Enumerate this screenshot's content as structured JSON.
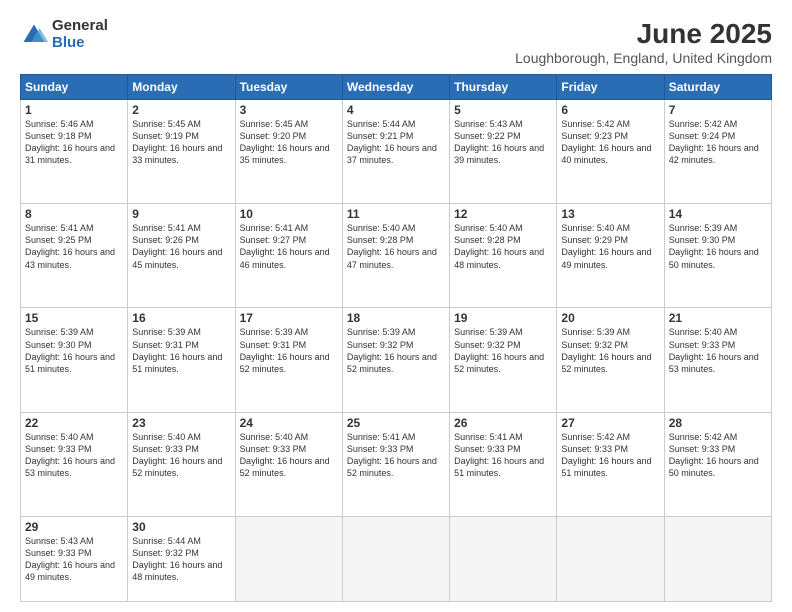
{
  "header": {
    "logo": {
      "general": "General",
      "blue": "Blue"
    },
    "title": "June 2025",
    "location": "Loughborough, England, United Kingdom"
  },
  "calendar": {
    "weekdays": [
      "Sunday",
      "Monday",
      "Tuesday",
      "Wednesday",
      "Thursday",
      "Friday",
      "Saturday"
    ],
    "weeks": [
      [
        null,
        {
          "day": "2",
          "sunrise": "5:45 AM",
          "sunset": "9:19 PM",
          "daylight": "16 hours and 33 minutes."
        },
        {
          "day": "3",
          "sunrise": "5:45 AM",
          "sunset": "9:20 PM",
          "daylight": "16 hours and 35 minutes."
        },
        {
          "day": "4",
          "sunrise": "5:44 AM",
          "sunset": "9:21 PM",
          "daylight": "16 hours and 37 minutes."
        },
        {
          "day": "5",
          "sunrise": "5:43 AM",
          "sunset": "9:22 PM",
          "daylight": "16 hours and 39 minutes."
        },
        {
          "day": "6",
          "sunrise": "5:42 AM",
          "sunset": "9:23 PM",
          "daylight": "16 hours and 40 minutes."
        },
        {
          "day": "7",
          "sunrise": "5:42 AM",
          "sunset": "9:24 PM",
          "daylight": "16 hours and 42 minutes."
        }
      ],
      [
        {
          "day": "1",
          "sunrise": "5:46 AM",
          "sunset": "9:18 PM",
          "daylight": "16 hours and 31 minutes."
        },
        null,
        null,
        null,
        null,
        null,
        null
      ],
      [
        {
          "day": "8",
          "sunrise": "5:41 AM",
          "sunset": "9:25 PM",
          "daylight": "16 hours and 43 minutes."
        },
        {
          "day": "9",
          "sunrise": "5:41 AM",
          "sunset": "9:26 PM",
          "daylight": "16 hours and 45 minutes."
        },
        {
          "day": "10",
          "sunrise": "5:41 AM",
          "sunset": "9:27 PM",
          "daylight": "16 hours and 46 minutes."
        },
        {
          "day": "11",
          "sunrise": "5:40 AM",
          "sunset": "9:28 PM",
          "daylight": "16 hours and 47 minutes."
        },
        {
          "day": "12",
          "sunrise": "5:40 AM",
          "sunset": "9:28 PM",
          "daylight": "16 hours and 48 minutes."
        },
        {
          "day": "13",
          "sunrise": "5:40 AM",
          "sunset": "9:29 PM",
          "daylight": "16 hours and 49 minutes."
        },
        {
          "day": "14",
          "sunrise": "5:39 AM",
          "sunset": "9:30 PM",
          "daylight": "16 hours and 50 minutes."
        }
      ],
      [
        {
          "day": "15",
          "sunrise": "5:39 AM",
          "sunset": "9:30 PM",
          "daylight": "16 hours and 51 minutes."
        },
        {
          "day": "16",
          "sunrise": "5:39 AM",
          "sunset": "9:31 PM",
          "daylight": "16 hours and 51 minutes."
        },
        {
          "day": "17",
          "sunrise": "5:39 AM",
          "sunset": "9:31 PM",
          "daylight": "16 hours and 52 minutes."
        },
        {
          "day": "18",
          "sunrise": "5:39 AM",
          "sunset": "9:32 PM",
          "daylight": "16 hours and 52 minutes."
        },
        {
          "day": "19",
          "sunrise": "5:39 AM",
          "sunset": "9:32 PM",
          "daylight": "16 hours and 52 minutes."
        },
        {
          "day": "20",
          "sunrise": "5:39 AM",
          "sunset": "9:32 PM",
          "daylight": "16 hours and 52 minutes."
        },
        {
          "day": "21",
          "sunrise": "5:40 AM",
          "sunset": "9:33 PM",
          "daylight": "16 hours and 53 minutes."
        }
      ],
      [
        {
          "day": "22",
          "sunrise": "5:40 AM",
          "sunset": "9:33 PM",
          "daylight": "16 hours and 53 minutes."
        },
        {
          "day": "23",
          "sunrise": "5:40 AM",
          "sunset": "9:33 PM",
          "daylight": "16 hours and 52 minutes."
        },
        {
          "day": "24",
          "sunrise": "5:40 AM",
          "sunset": "9:33 PM",
          "daylight": "16 hours and 52 minutes."
        },
        {
          "day": "25",
          "sunrise": "5:41 AM",
          "sunset": "9:33 PM",
          "daylight": "16 hours and 52 minutes."
        },
        {
          "day": "26",
          "sunrise": "5:41 AM",
          "sunset": "9:33 PM",
          "daylight": "16 hours and 51 minutes."
        },
        {
          "day": "27",
          "sunrise": "5:42 AM",
          "sunset": "9:33 PM",
          "daylight": "16 hours and 51 minutes."
        },
        {
          "day": "28",
          "sunrise": "5:42 AM",
          "sunset": "9:33 PM",
          "daylight": "16 hours and 50 minutes."
        }
      ],
      [
        {
          "day": "29",
          "sunrise": "5:43 AM",
          "sunset": "9:33 PM",
          "daylight": "16 hours and 49 minutes."
        },
        {
          "day": "30",
          "sunrise": "5:44 AM",
          "sunset": "9:32 PM",
          "daylight": "16 hours and 48 minutes."
        },
        null,
        null,
        null,
        null,
        null
      ]
    ]
  }
}
